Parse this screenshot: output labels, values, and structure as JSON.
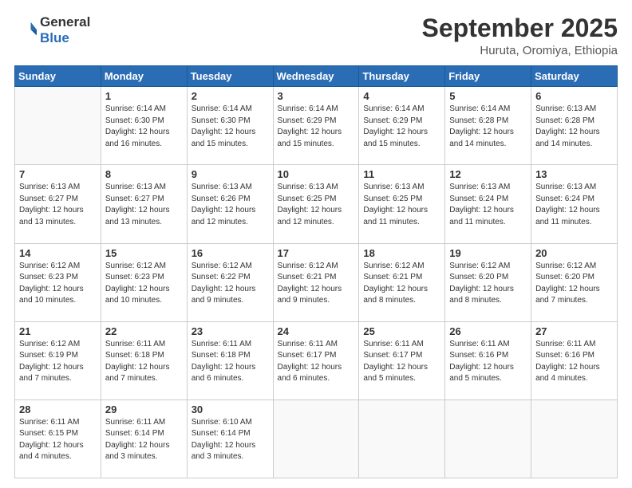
{
  "logo": {
    "line1": "General",
    "line2": "Blue"
  },
  "header": {
    "month": "September 2025",
    "location": "Huruta, Oromiya, Ethiopia"
  },
  "weekdays": [
    "Sunday",
    "Monday",
    "Tuesday",
    "Wednesday",
    "Thursday",
    "Friday",
    "Saturday"
  ],
  "weeks": [
    [
      {
        "day": "",
        "info": ""
      },
      {
        "day": "1",
        "info": "Sunrise: 6:14 AM\nSunset: 6:30 PM\nDaylight: 12 hours\nand 16 minutes."
      },
      {
        "day": "2",
        "info": "Sunrise: 6:14 AM\nSunset: 6:30 PM\nDaylight: 12 hours\nand 15 minutes."
      },
      {
        "day": "3",
        "info": "Sunrise: 6:14 AM\nSunset: 6:29 PM\nDaylight: 12 hours\nand 15 minutes."
      },
      {
        "day": "4",
        "info": "Sunrise: 6:14 AM\nSunset: 6:29 PM\nDaylight: 12 hours\nand 15 minutes."
      },
      {
        "day": "5",
        "info": "Sunrise: 6:14 AM\nSunset: 6:28 PM\nDaylight: 12 hours\nand 14 minutes."
      },
      {
        "day": "6",
        "info": "Sunrise: 6:13 AM\nSunset: 6:28 PM\nDaylight: 12 hours\nand 14 minutes."
      }
    ],
    [
      {
        "day": "7",
        "info": "Sunrise: 6:13 AM\nSunset: 6:27 PM\nDaylight: 12 hours\nand 13 minutes."
      },
      {
        "day": "8",
        "info": "Sunrise: 6:13 AM\nSunset: 6:27 PM\nDaylight: 12 hours\nand 13 minutes."
      },
      {
        "day": "9",
        "info": "Sunrise: 6:13 AM\nSunset: 6:26 PM\nDaylight: 12 hours\nand 12 minutes."
      },
      {
        "day": "10",
        "info": "Sunrise: 6:13 AM\nSunset: 6:25 PM\nDaylight: 12 hours\nand 12 minutes."
      },
      {
        "day": "11",
        "info": "Sunrise: 6:13 AM\nSunset: 6:25 PM\nDaylight: 12 hours\nand 11 minutes."
      },
      {
        "day": "12",
        "info": "Sunrise: 6:13 AM\nSunset: 6:24 PM\nDaylight: 12 hours\nand 11 minutes."
      },
      {
        "day": "13",
        "info": "Sunrise: 6:13 AM\nSunset: 6:24 PM\nDaylight: 12 hours\nand 11 minutes."
      }
    ],
    [
      {
        "day": "14",
        "info": "Sunrise: 6:12 AM\nSunset: 6:23 PM\nDaylight: 12 hours\nand 10 minutes."
      },
      {
        "day": "15",
        "info": "Sunrise: 6:12 AM\nSunset: 6:23 PM\nDaylight: 12 hours\nand 10 minutes."
      },
      {
        "day": "16",
        "info": "Sunrise: 6:12 AM\nSunset: 6:22 PM\nDaylight: 12 hours\nand 9 minutes."
      },
      {
        "day": "17",
        "info": "Sunrise: 6:12 AM\nSunset: 6:21 PM\nDaylight: 12 hours\nand 9 minutes."
      },
      {
        "day": "18",
        "info": "Sunrise: 6:12 AM\nSunset: 6:21 PM\nDaylight: 12 hours\nand 8 minutes."
      },
      {
        "day": "19",
        "info": "Sunrise: 6:12 AM\nSunset: 6:20 PM\nDaylight: 12 hours\nand 8 minutes."
      },
      {
        "day": "20",
        "info": "Sunrise: 6:12 AM\nSunset: 6:20 PM\nDaylight: 12 hours\nand 7 minutes."
      }
    ],
    [
      {
        "day": "21",
        "info": "Sunrise: 6:12 AM\nSunset: 6:19 PM\nDaylight: 12 hours\nand 7 minutes."
      },
      {
        "day": "22",
        "info": "Sunrise: 6:11 AM\nSunset: 6:18 PM\nDaylight: 12 hours\nand 7 minutes."
      },
      {
        "day": "23",
        "info": "Sunrise: 6:11 AM\nSunset: 6:18 PM\nDaylight: 12 hours\nand 6 minutes."
      },
      {
        "day": "24",
        "info": "Sunrise: 6:11 AM\nSunset: 6:17 PM\nDaylight: 12 hours\nand 6 minutes."
      },
      {
        "day": "25",
        "info": "Sunrise: 6:11 AM\nSunset: 6:17 PM\nDaylight: 12 hours\nand 5 minutes."
      },
      {
        "day": "26",
        "info": "Sunrise: 6:11 AM\nSunset: 6:16 PM\nDaylight: 12 hours\nand 5 minutes."
      },
      {
        "day": "27",
        "info": "Sunrise: 6:11 AM\nSunset: 6:16 PM\nDaylight: 12 hours\nand 4 minutes."
      }
    ],
    [
      {
        "day": "28",
        "info": "Sunrise: 6:11 AM\nSunset: 6:15 PM\nDaylight: 12 hours\nand 4 minutes."
      },
      {
        "day": "29",
        "info": "Sunrise: 6:11 AM\nSunset: 6:14 PM\nDaylight: 12 hours\nand 3 minutes."
      },
      {
        "day": "30",
        "info": "Sunrise: 6:10 AM\nSunset: 6:14 PM\nDaylight: 12 hours\nand 3 minutes."
      },
      {
        "day": "",
        "info": ""
      },
      {
        "day": "",
        "info": ""
      },
      {
        "day": "",
        "info": ""
      },
      {
        "day": "",
        "info": ""
      }
    ]
  ]
}
